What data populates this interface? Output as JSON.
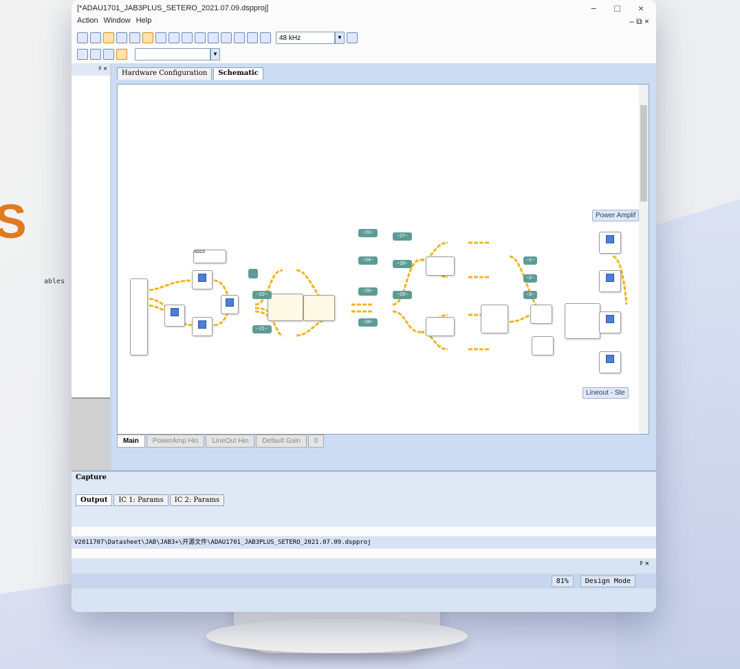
{
  "window": {
    "title": "[*ADAU1701_JAB3PLUS_SETERO_2021.07.09.dspproj]",
    "controls": [
      "−",
      "□",
      "×"
    ]
  },
  "menu": {
    "items": [
      "Action",
      "Window",
      "Help"
    ],
    "mdi_controls": "– ⧉ ×"
  },
  "toolbar": {
    "sample_rate": "48 kHz"
  },
  "left_panel": {
    "header_controls": "ᵖ ×",
    "partial_label": "ables"
  },
  "doc_tabs": [
    {
      "label": "Hardware Configuration",
      "active": false
    },
    {
      "label": "Schematic",
      "active": true
    }
  ],
  "schematic": {
    "adc_block": "ADC0",
    "power_amp_label": "Power Amplif",
    "lineout_label": "Lineout - Ste",
    "teal_labels": [
      "~22~",
      "~21~",
      "~23~",
      "~24~",
      "~25~",
      "~26~",
      "~27~",
      "~28~",
      "~29~",
      "~1~",
      "~2~",
      "~3~"
    ]
  },
  "sheet_tabs": [
    {
      "label": "Main",
      "active": true
    },
    {
      "label": "PowerAmp Hin",
      "active": false
    },
    {
      "label": "LineOut Hin",
      "active": false
    },
    {
      "label": "Default Gain",
      "active": false
    },
    {
      "label": "0",
      "active": false
    }
  ],
  "capture": {
    "title": "Capture",
    "tabs": [
      {
        "label": "Output",
        "active": true
      },
      {
        "label": "IC 1: Params",
        "active": false
      },
      {
        "label": "IC 2: Params",
        "active": false
      }
    ]
  },
  "status_path": "V2011707\\Datasheet\\JAB\\JAB3+\\开源文件\\ADAU1701_JAB3PLUS_SETERO_2021.07.09.dspproj",
  "bottom_panel": {
    "controls": "ᵖ ×"
  },
  "statusbar": {
    "zoom": "81%",
    "mode": "Design Mode"
  },
  "decor": {
    "orange_glyph": "S",
    "accent": "#e07a1f"
  }
}
